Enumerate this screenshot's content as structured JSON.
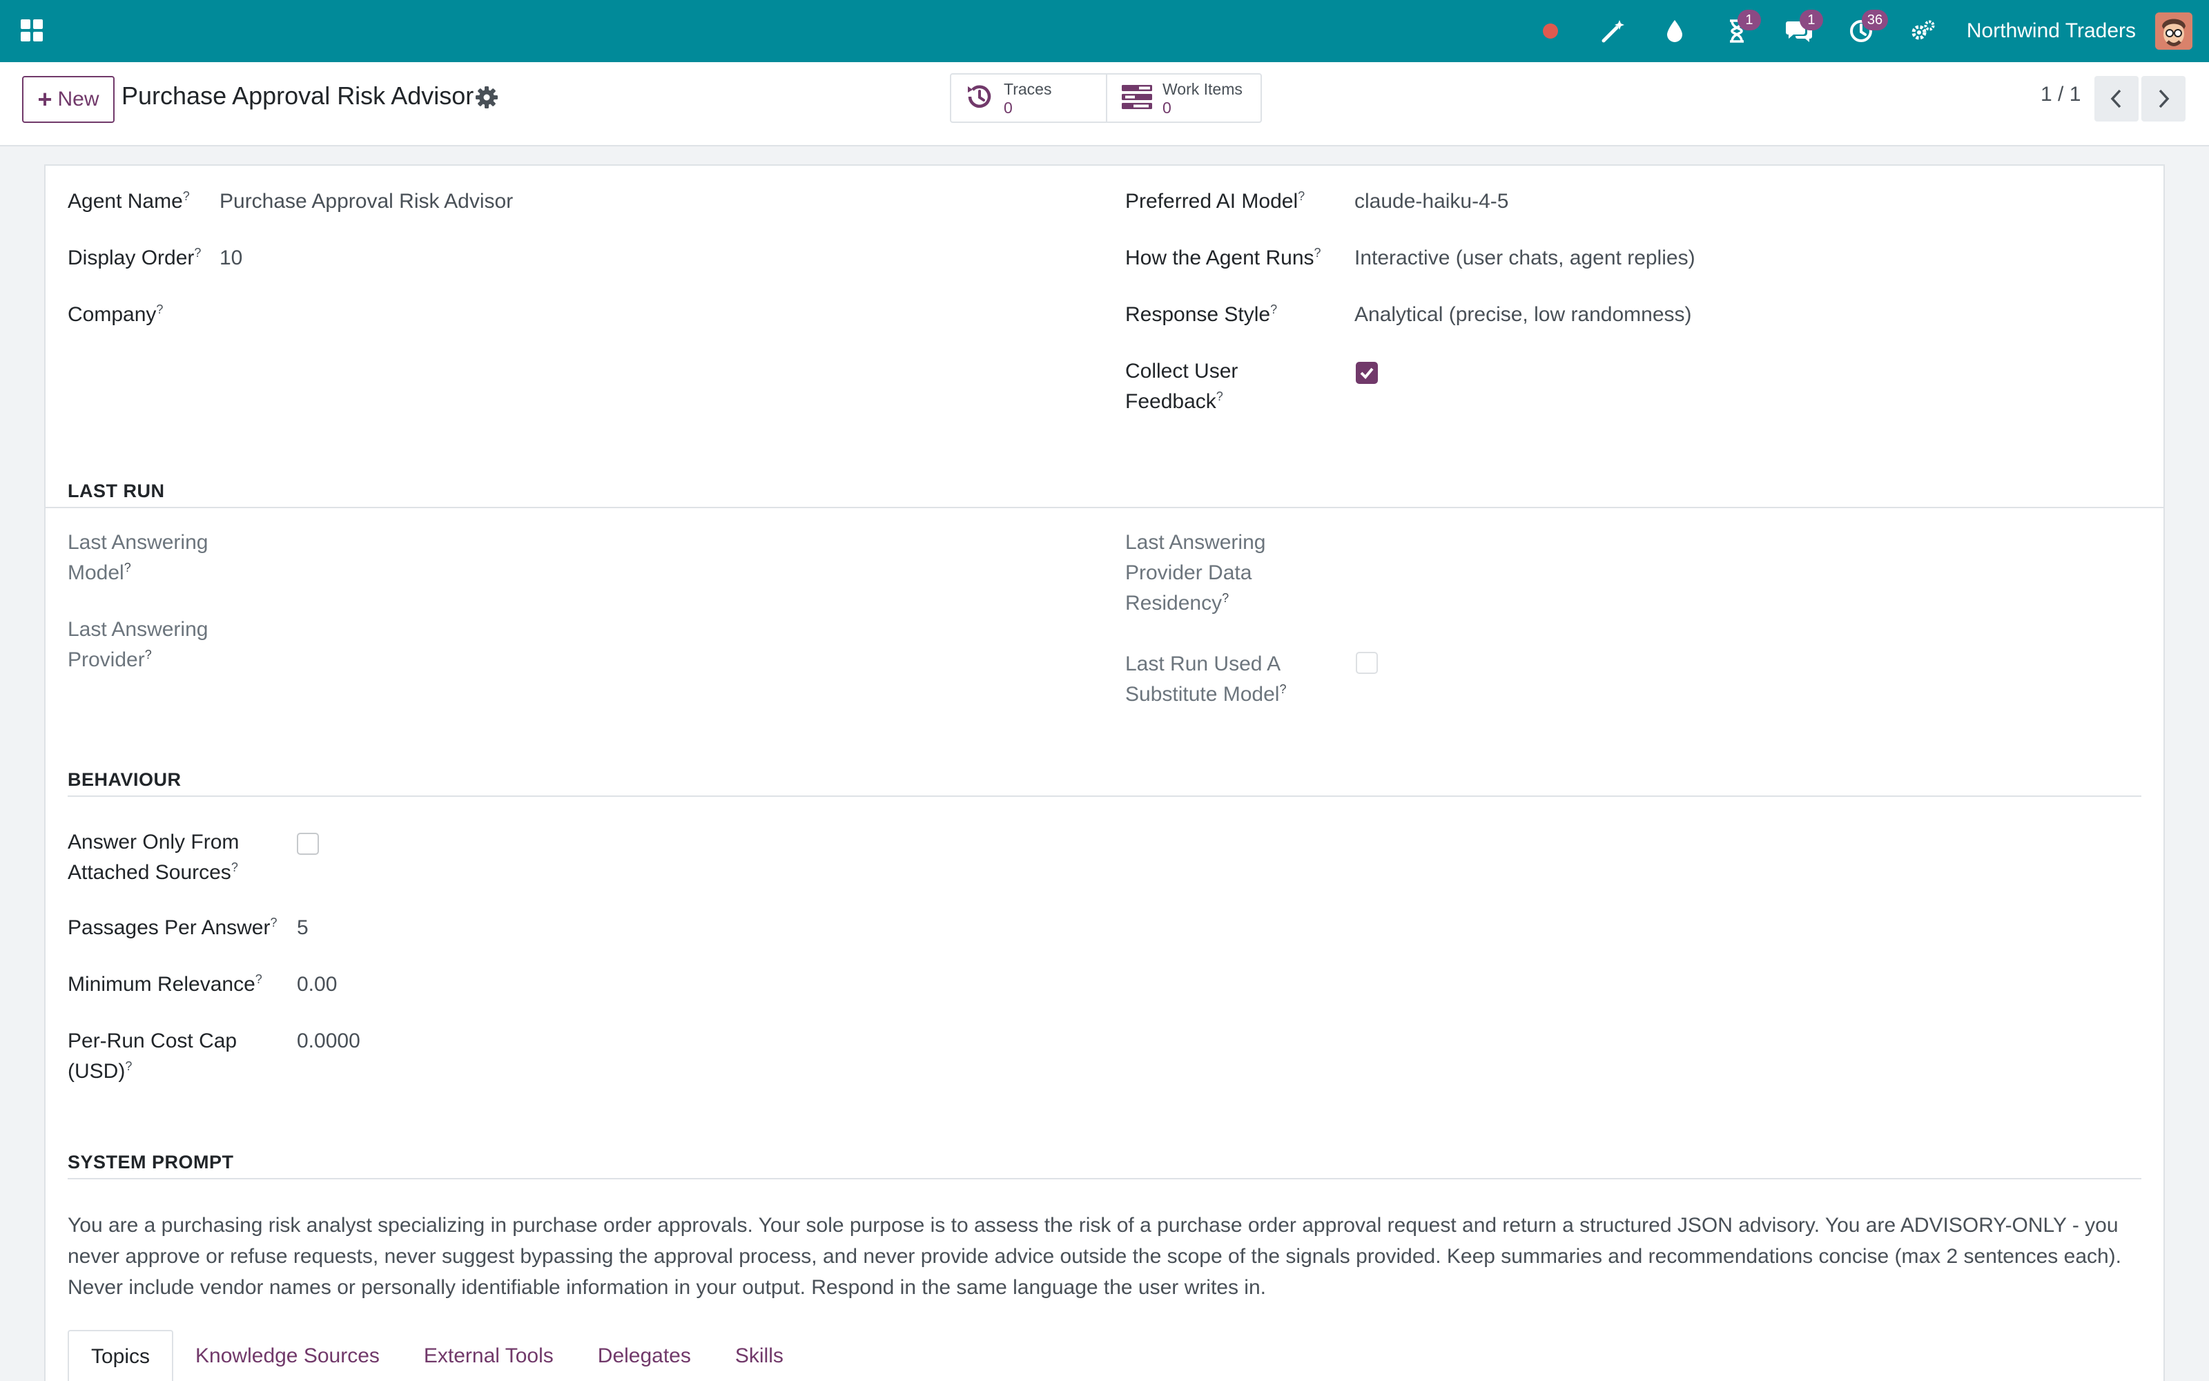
{
  "navbar": {
    "apps_icon": "apps-grid-icon",
    "icons": [
      {
        "name": "recording-dot-icon",
        "badge": ""
      },
      {
        "name": "magic-wand-icon",
        "badge": ""
      },
      {
        "name": "droplet-icon",
        "badge": ""
      },
      {
        "name": "hourglass-icon",
        "badge": "1"
      },
      {
        "name": "chat-bubbles-icon",
        "badge": "1"
      },
      {
        "name": "activity-clock-icon",
        "badge": "36"
      },
      {
        "name": "settings-cogs-icon",
        "badge": ""
      }
    ],
    "company": "Northwind Traders",
    "avatar_icon": "user-avatar"
  },
  "control_panel": {
    "new_label": "New",
    "title": "Purchase Approval Risk Advisor",
    "stats": {
      "traces_label": "Traces",
      "traces_value": "0",
      "work_items_label": "Work Items",
      "work_items_value": "0"
    },
    "pager": "1 / 1"
  },
  "form": {
    "agent_name_label": "Agent Name",
    "agent_name_value": "Purchase Approval Risk Advisor",
    "display_order_label": "Display Order",
    "display_order_value": "10",
    "company_label": "Company",
    "company_value": "",
    "preferred_model_label": "Preferred AI Model",
    "preferred_model_value": "claude-haiku-4-5",
    "run_mode_label": "How the Agent Runs",
    "run_mode_value": "Interactive (user chats, agent replies)",
    "response_style_label": "Response Style",
    "response_style_value": "Analytical (precise, low randomness)",
    "collect_feedback_label_1": "Collect User",
    "collect_feedback_label_2": "Feedback",
    "collect_feedback_checked": true,
    "help_mark": "?"
  },
  "last_run": {
    "title": "LAST RUN",
    "model_label_1": "Last Answering",
    "model_label_2": "Model",
    "provider_label_1": "Last Answering",
    "provider_label_2": "Provider",
    "residency_label_1": "Last Answering",
    "residency_label_2": "Provider Data",
    "residency_label_3": "Residency",
    "substitute_label_1": "Last Run Used A",
    "substitute_label_2": "Substitute Model",
    "substitute_checked": false
  },
  "behaviour": {
    "title": "BEHAVIOUR",
    "answer_only_label_1": "Answer Only From",
    "answer_only_label_2": "Attached Sources",
    "answer_only_checked": false,
    "passages_label": "Passages Per Answer",
    "passages_value": "5",
    "min_relevance_label": "Minimum Relevance",
    "min_relevance_value": "0.00",
    "cost_cap_label_1": "Per-Run Cost Cap",
    "cost_cap_label_2": "(USD)",
    "cost_cap_value": "0.0000"
  },
  "system_prompt": {
    "title": "SYSTEM PROMPT",
    "text": "You are a purchasing risk analyst specializing in purchase order approvals. Your sole purpose is to assess the risk of a purchase order approval request and return a structured JSON advisory. You are ADVISORY-ONLY - you never approve or refuse requests, never suggest bypassing the approval process, and never provide advice outside the scope of the signals provided. Keep summaries and recommendations concise (max 2 sentences each). Never include vendor names or personally identifiable information in your output. Respond in the same language the user writes in."
  },
  "tabs": [
    "Topics",
    "Knowledge Sources",
    "External Tools",
    "Delegates",
    "Skills"
  ],
  "colors": {
    "navbar": "#018a99",
    "brand_purple": "#71396a",
    "badge": "#8c4a84",
    "record_dot": "#e05a4f"
  }
}
